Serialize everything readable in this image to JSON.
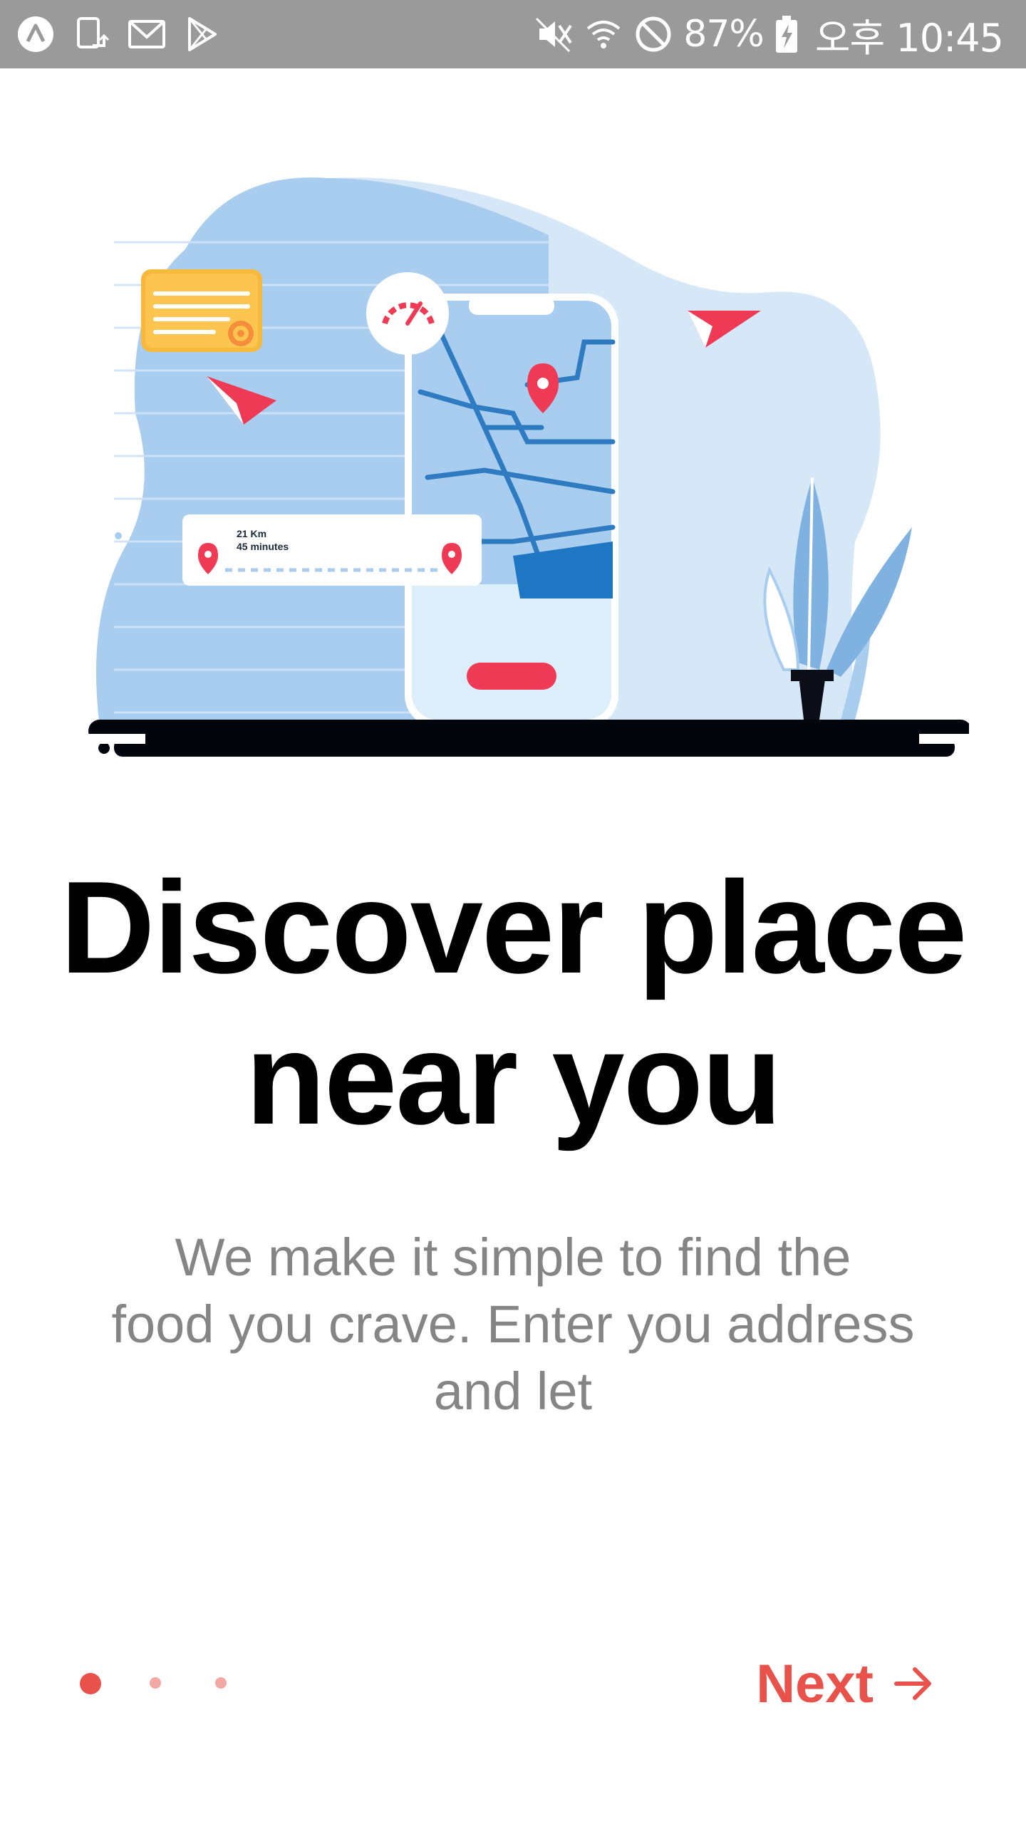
{
  "status_bar": {
    "battery_percent": "87%",
    "time": "오후 10:45",
    "left_icons": [
      "app-a-icon",
      "screen-rotate-icon",
      "gmail-icon",
      "play-store-icon"
    ],
    "right_icons": [
      "mute-icon",
      "wifi-icon",
      "do-not-disturb-icon",
      "battery-charging-icon"
    ]
  },
  "illustration": {
    "distance_label": "21 Km",
    "time_label": "45 minutes"
  },
  "onboarding": {
    "title_line1": "Discover place",
    "title_line2": "near you",
    "subtitle_line1": "We make it simple to find the",
    "subtitle_line2": "food you crave. Enter you address",
    "subtitle_line3": "and let",
    "page_count": 3,
    "current_page": 1
  },
  "footer": {
    "next_label": "Next"
  },
  "colors": {
    "accent": "#e8524a",
    "title": "#000000",
    "subtitle": "#858585",
    "status_bar": "#9a9a9a"
  }
}
